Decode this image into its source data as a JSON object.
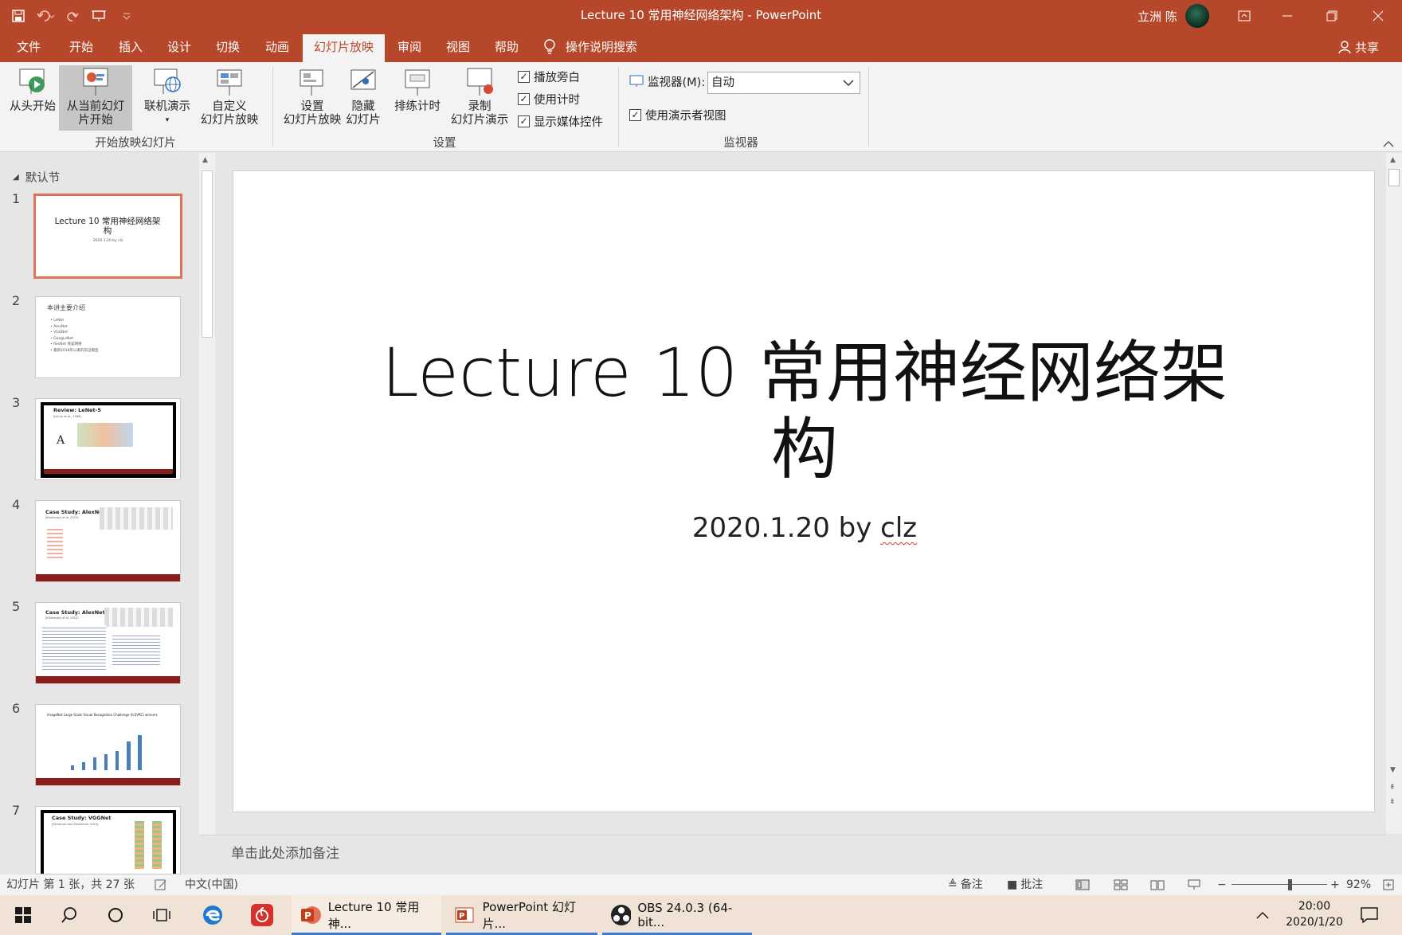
{
  "window": {
    "title": "Lecture 10 常用神经网络架构  -  PowerPoint",
    "user_name": "立洲 陈",
    "share_label": "共享"
  },
  "qat": {
    "icons": [
      "save-icon",
      "undo-icon",
      "redo-icon",
      "present-icon",
      "customize-icon"
    ]
  },
  "tabs": [
    {
      "label": "文件"
    },
    {
      "label": "开始"
    },
    {
      "label": "插入"
    },
    {
      "label": "设计"
    },
    {
      "label": "切换"
    },
    {
      "label": "动画"
    },
    {
      "label": "幻灯片放映"
    },
    {
      "label": "审阅"
    },
    {
      "label": "视图"
    },
    {
      "label": "帮助"
    }
  ],
  "tell_me": "操作说明搜索",
  "ribbon": {
    "start_group": {
      "label": "开始放映幻灯片",
      "from_beginning": "从头开始",
      "from_current": "从当前幻灯片开始",
      "online_present": "联机演示",
      "custom_l1": "自定义",
      "custom_l2": "幻灯片放映"
    },
    "setup_group": {
      "label": "设置",
      "setup_l1": "设置",
      "setup_l2": "幻灯片放映",
      "hide_l1": "隐藏",
      "hide_l2": "幻灯片",
      "rehearse": "排练计时",
      "record_l1": "录制",
      "record_l2": "幻灯片演示",
      "play_narrations": "播放旁白",
      "use_timings": "使用计时",
      "show_media_controls": "显示媒体控件"
    },
    "monitors_group": {
      "label": "监视器",
      "monitor_label": "监视器(M):",
      "monitor_value": "自动",
      "presenter_view": "使用演示者视图"
    }
  },
  "thumbnails": {
    "section_name": "默认节",
    "slides": [
      {
        "num": "1",
        "title": "Lecture 10 常用神经网络架构",
        "sub": "2020.1.20 by clz"
      },
      {
        "num": "2",
        "title": "本讲主要介绍",
        "lines": [
          "• LeNet",
          "• AlexNet",
          "• VGGNet",
          "• GoogLeNet",
          "• ResNet 残差网络",
          "• 最新2018年以来的前沿模型"
        ]
      },
      {
        "num": "3",
        "title": "Review: LeNet-5",
        "sub": "[LeCun et al., 1998]"
      },
      {
        "num": "4",
        "title": "Case Study: AlexNet",
        "sub": "[Krizhevsky et al. 2012]"
      },
      {
        "num": "5",
        "title": "Case Study: AlexNet",
        "sub": "[Krizhevsky et al. 2012]"
      },
      {
        "num": "6",
        "title": "ImageNet Large Scale Visual Recognition Challenge (ILSVRC) winners"
      },
      {
        "num": "7",
        "title": "Case Study: VGGNet",
        "sub": "[Simonyan and Zisserman, 2014]"
      }
    ]
  },
  "slide": {
    "title_line1": "Lecture 10 常用神经网络架",
    "title_line2": "构",
    "subtitle_prefix": "2020.1.20 by ",
    "subtitle_author": "clz"
  },
  "notes_placeholder": "单击此处添加备注",
  "status": {
    "slide_info": "幻灯片 第 1 张，共 27 张",
    "language": "中文(中国)",
    "notes": "备注",
    "comments": "批注",
    "zoom": "92%",
    "zoom_fraction": 0.62
  },
  "taskbar": {
    "apps": [
      {
        "label": "Lecture 10 常用神..."
      },
      {
        "label": "PowerPoint 幻灯片..."
      },
      {
        "label": "OBS 24.0.3 (64-bit..."
      }
    ],
    "time": "20:00",
    "date": "2020/1/20"
  },
  "colors": {
    "accent": "#b7472a",
    "selection_border": "#e0725a"
  }
}
